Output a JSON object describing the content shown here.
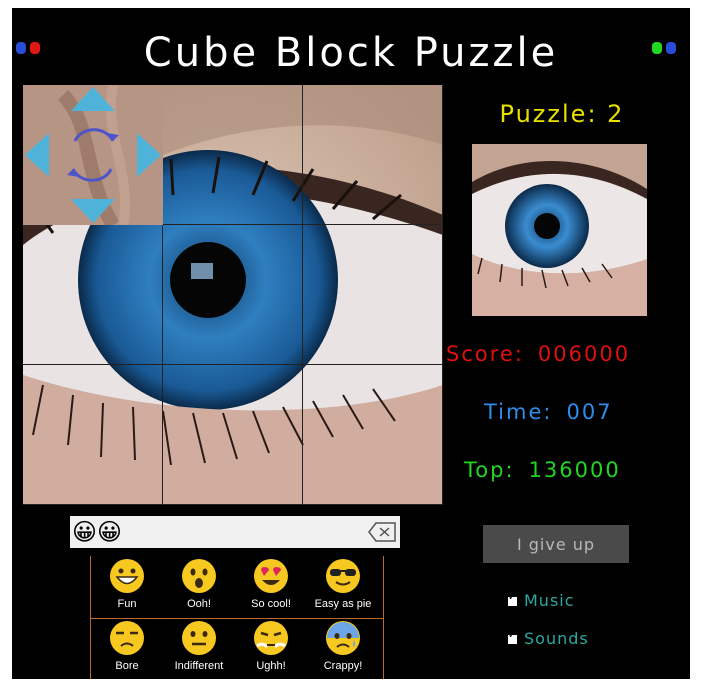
{
  "title": "Cube Block Puzzle",
  "puzzle": {
    "label": "Puzzle:",
    "number": "2"
  },
  "score": {
    "label": "Score:",
    "value": "006000"
  },
  "time": {
    "label": "Time:",
    "value": "007"
  },
  "top": {
    "label": "Top:",
    "value": "136000"
  },
  "give_up": "I give up",
  "options": {
    "music": "Music",
    "sounds": "Sounds"
  },
  "emoji_selected": "😀😀",
  "reactions": [
    {
      "label": "Fun",
      "icon": "grinning-face-icon"
    },
    {
      "label": "Ooh!",
      "icon": "hushed-face-icon"
    },
    {
      "label": "So cool!",
      "icon": "heart-eyes-face-icon"
    },
    {
      "label": "Easy as pie",
      "icon": "sunglasses-face-icon"
    },
    {
      "label": "Bore",
      "icon": "unamused-face-icon"
    },
    {
      "label": "Indifferent",
      "icon": "neutral-face-icon"
    },
    {
      "label": "Ughh!",
      "icon": "steam-face-icon"
    },
    {
      "label": "Crappy!",
      "icon": "anxious-face-icon"
    }
  ],
  "colors": {
    "puzzle": "#e8e000",
    "score": "#e01010",
    "time": "#2f8ce8",
    "top": "#22d622",
    "options": "#2aa8a0",
    "dpad": "#4fb3d9"
  }
}
